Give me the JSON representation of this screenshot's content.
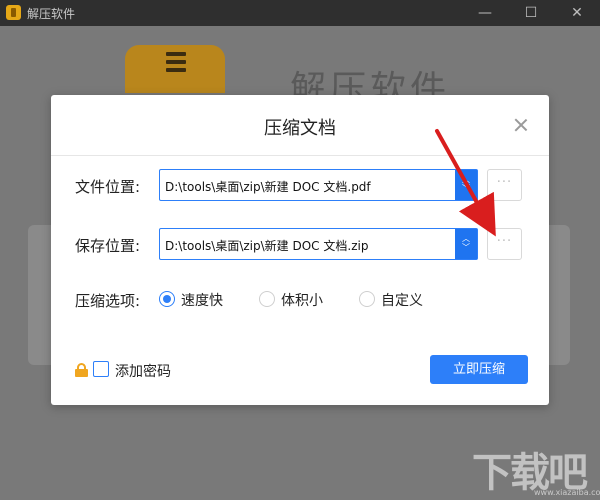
{
  "app": {
    "title": "解压软件",
    "heading": "解压软件",
    "window_controls": {
      "minimize": "—",
      "maximize": "☐",
      "close": "✕"
    },
    "logo_icon": "zip-archive-icon"
  },
  "dialog": {
    "title": "压缩文档",
    "file_location": {
      "label": "文件位置:",
      "value": "D:\\tools\\桌面\\zip\\新建 DOC 文档.pdf",
      "browse_label": "···"
    },
    "save_location": {
      "label": "保存位置:",
      "value": "D:\\tools\\桌面\\zip\\新建 DOC 文档.zip",
      "browse_label": "···"
    },
    "compress_options": {
      "label": "压缩选项:",
      "options": [
        {
          "label": "速度快",
          "checked": true
        },
        {
          "label": "体积小",
          "checked": false
        },
        {
          "label": "自定义",
          "checked": false
        }
      ]
    },
    "add_password": {
      "label": "添加密码",
      "checked": false
    },
    "submit_label": "立即压缩"
  },
  "watermark": {
    "text": "下载吧",
    "url": "www.xiazaiba.com"
  },
  "colors": {
    "accent": "#2d7ff9",
    "lock": "#f0a620",
    "annotation_arrow": "#d91e1e"
  }
}
